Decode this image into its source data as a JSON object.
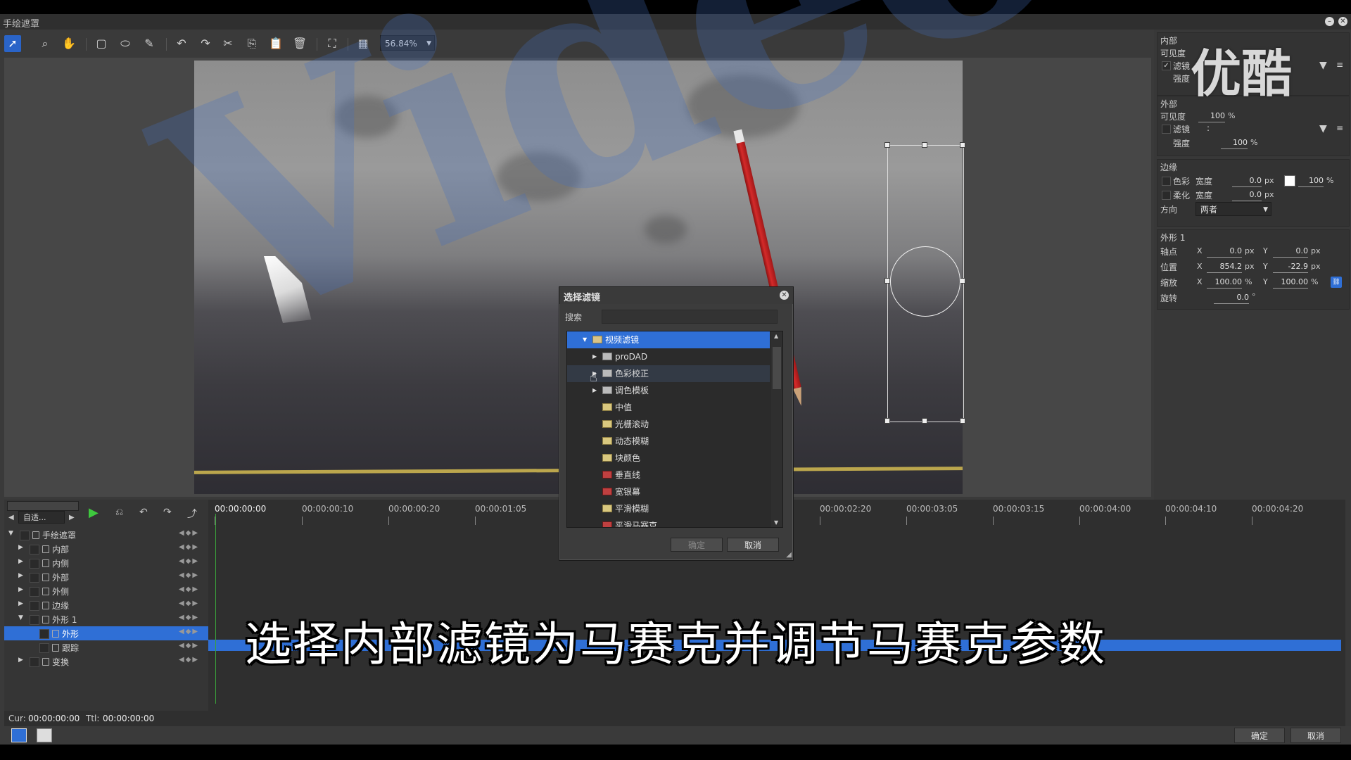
{
  "window": {
    "title": "手绘遮罩"
  },
  "toolbar": {
    "zoom": "56.84%"
  },
  "right_panel": {
    "inner": {
      "heading": "内部",
      "visibility_label": "可见度",
      "filter_label": "滤镜",
      "strength_label": "强度"
    },
    "outer": {
      "heading": "外部",
      "visibility_label": "可见度",
      "visibility_value": "100",
      "visibility_unit": "%",
      "filter_label": "滤镜",
      "filter_value": ":",
      "strength_label": "强度",
      "strength_value": "100",
      "strength_unit": "%"
    },
    "edge": {
      "heading": "边缘",
      "color_label": "色彩",
      "width_label": "宽度",
      "color_width_value": "0.0",
      "px": "px",
      "color_opacity_value": "100",
      "pct": "%",
      "feather_label": "柔化",
      "feather_width_value": "0.0",
      "direction_label": "方向",
      "direction_value": "两者"
    },
    "shape": {
      "heading": "外形 1",
      "anchor_label": "轴点",
      "anchor_x": "0.0",
      "anchor_y": "0.0",
      "position_label": "位置",
      "position_x": "854.2",
      "position_y": "-22.9",
      "scale_label": "缩放",
      "scale_x": "100.00",
      "scale_y": "100.00",
      "rotate_label": "旋转",
      "rotate_value": "0.0",
      "deg": "°",
      "x": "X",
      "y": "Y",
      "px": "px",
      "pct": "%"
    }
  },
  "dialog": {
    "title": "选择滤镜",
    "search_label": "搜索",
    "search_value": "",
    "ok": "确定",
    "cancel": "取消",
    "tree": [
      {
        "label": "视频滤镜",
        "level": 0,
        "icon": "folder"
      },
      {
        "label": "proDAD",
        "level": 1,
        "icon": "group"
      },
      {
        "label": "色彩校正",
        "level": 1,
        "icon": "group"
      },
      {
        "label": "调色模板",
        "level": 1,
        "icon": "group"
      },
      {
        "label": "中值",
        "level": 1,
        "icon": "fx"
      },
      {
        "label": "光栅滚动",
        "level": 1,
        "icon": "fx"
      },
      {
        "label": "动态模糊",
        "level": 1,
        "icon": "fx"
      },
      {
        "label": "块颜色",
        "level": 1,
        "icon": "fx"
      },
      {
        "label": "垂直线",
        "level": 1,
        "icon": "fx2"
      },
      {
        "label": "宽银幕",
        "level": 1,
        "icon": "fx2"
      },
      {
        "label": "平滑模糊",
        "level": 1,
        "icon": "fx"
      },
      {
        "label": "平滑马赛克",
        "level": 1,
        "icon": "fx2"
      }
    ]
  },
  "timeline": {
    "mode": "自适...",
    "ruler": [
      "00:00:00:00",
      "00:00:00:10",
      "00:00:00:20",
      "00:00:01:05",
      "00:00:02:20",
      "00:00:03:05",
      "00:00:03:15",
      "00:00:04:00",
      "00:00:04:10",
      "00:00:04:20"
    ],
    "tracks": [
      {
        "label": "手绘遮罩"
      },
      {
        "label": "内部"
      },
      {
        "label": "内侧"
      },
      {
        "label": "外部"
      },
      {
        "label": "外侧"
      },
      {
        "label": "边缘"
      },
      {
        "label": "外形 1"
      },
      {
        "label": "外形"
      },
      {
        "label": "跟踪"
      },
      {
        "label": "变换"
      }
    ],
    "cur_label": "Cur:",
    "cur_value": "00:00:00:00",
    "ttl_label": "Ttl:",
    "ttl_value": "00:00:00:00"
  },
  "footer": {
    "ok": "确定",
    "cancel": "取消"
  },
  "caption": "选择内部滤镜为马赛克并调节马赛克参数",
  "logo": "优酷"
}
